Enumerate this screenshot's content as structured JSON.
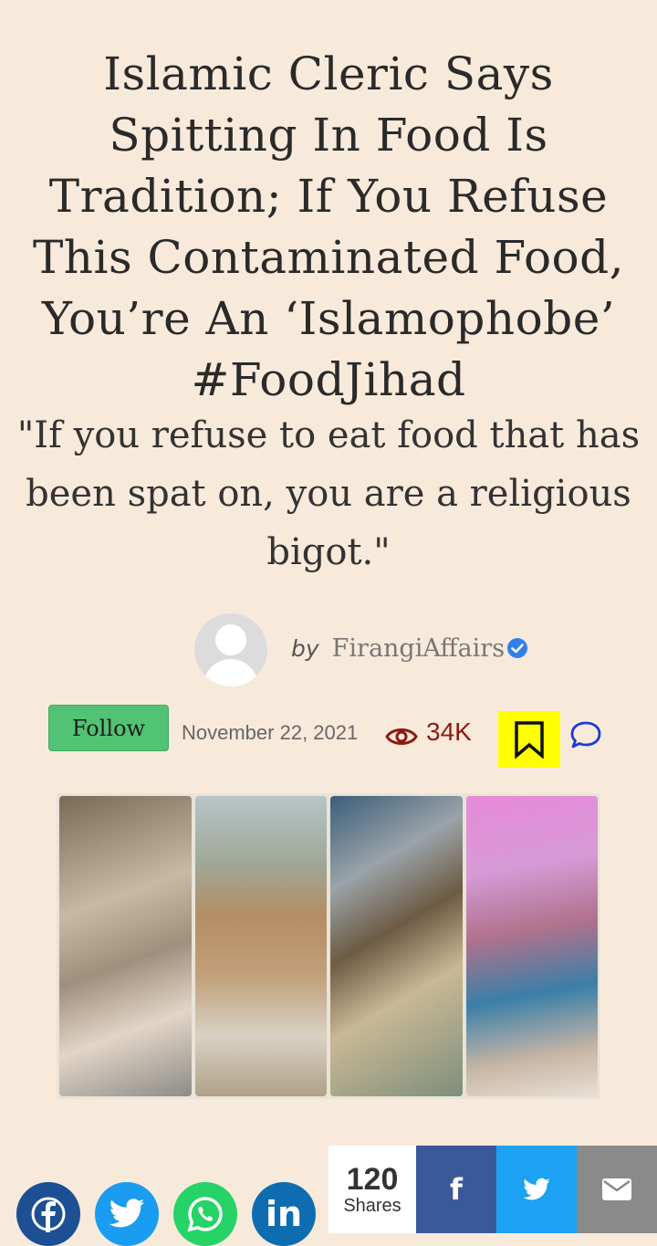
{
  "article": {
    "title": "Islamic Cleric Says Spitting In Food Is Tradition; If You Refuse This Contaminated Food, You’re An ‘Islamophobe’ #FoodJihad",
    "subtitle": "\"If you refuse to eat food that has been spat on, you are a religious bigot.\""
  },
  "author": {
    "by": "by",
    "name": "FirangiAffairs",
    "follow_label": "Follow"
  },
  "meta": {
    "date": "November 22, 2021",
    "views": "34K"
  },
  "share": {
    "count": "120",
    "count_label": "Shares",
    "fb_letter": "f",
    "in_letters": "in"
  },
  "colors": {
    "background": "#f8eadb",
    "follow_green": "#52c374",
    "views_red": "#8b1a10",
    "bookmark_highlight": "#ffff00",
    "facebook": "#3b5998",
    "twitter": "#1da1f2",
    "whatsapp": "#25d366",
    "linkedin": "#0e6db0",
    "mail": "#8a8a8a"
  },
  "icons": [
    "verified-check-icon",
    "eye-icon",
    "bookmark-icon",
    "comment-icon",
    "facebook-icon",
    "twitter-icon",
    "whatsapp-icon",
    "linkedin-icon",
    "mail-icon"
  ]
}
